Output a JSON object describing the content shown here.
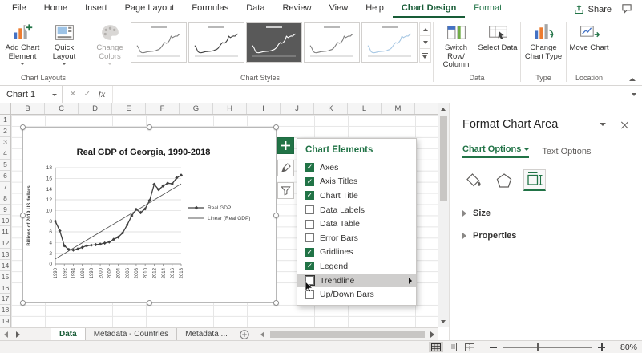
{
  "titlebar": {
    "tabs": [
      {
        "label": "File"
      },
      {
        "label": "Home"
      },
      {
        "label": "Insert"
      },
      {
        "label": "Page Layout"
      },
      {
        "label": "Formulas"
      },
      {
        "label": "Data"
      },
      {
        "label": "Review"
      },
      {
        "label": "View"
      },
      {
        "label": "Help"
      },
      {
        "label": "Chart Design",
        "contextual": true,
        "active": true
      },
      {
        "label": "Format",
        "contextual": true
      }
    ],
    "share_label": "Share"
  },
  "ribbon": {
    "add_chart_element": "Add Chart Element",
    "quick_layout": "Quick Layout",
    "change_colors": "Change Colors",
    "switch_row_column": "Switch Row/ Column",
    "select_data": "Select Data",
    "change_chart_type": "Change Chart Type",
    "move_chart": "Move Chart",
    "groups": {
      "chart_layouts": "Chart Layouts",
      "chart_styles": "Chart Styles",
      "data": "Data",
      "type": "Type",
      "location": "Location"
    },
    "chart_style_count": 5
  },
  "formula_bar": {
    "name_box": "Chart 1",
    "cancel_glyph": "✕",
    "enter_glyph": "✓",
    "fx_glyph": "fx",
    "formula_value": ""
  },
  "sheet": {
    "columns": [
      "B",
      "C",
      "D",
      "E",
      "F",
      "G",
      "H",
      "I",
      "J",
      "K",
      "L",
      "M"
    ],
    "rows": [
      "1",
      "2",
      "3",
      "4",
      "5",
      "6",
      "7",
      "8",
      "9",
      "10",
      "11",
      "12",
      "13",
      "14",
      "15",
      "16",
      "17",
      "18",
      "19"
    ]
  },
  "chart_elements_panel": {
    "title": "Chart Elements",
    "items": [
      {
        "label": "Axes",
        "checked": true
      },
      {
        "label": "Axis Titles",
        "checked": true
      },
      {
        "label": "Chart Title",
        "checked": true
      },
      {
        "label": "Data Labels",
        "checked": false
      },
      {
        "label": "Data Table",
        "checked": false
      },
      {
        "label": "Error Bars",
        "checked": false
      },
      {
        "label": "Gridlines",
        "checked": true
      },
      {
        "label": "Legend",
        "checked": true
      },
      {
        "label": "Trendline",
        "checked": false,
        "highlighted": true,
        "has_arrow": true,
        "cursor": true
      },
      {
        "label": "Up/Down Bars",
        "checked": false
      }
    ]
  },
  "sheet_tabs": {
    "tabs": [
      {
        "label": "Data",
        "active": true
      },
      {
        "label": "Metadata - Countries"
      },
      {
        "label": "Metadata ..."
      }
    ]
  },
  "task_pane": {
    "title": "Format Chart Area",
    "tab_chart_options": "Chart Options",
    "tab_text_options": "Text Options",
    "section_size": "Size",
    "section_properties": "Properties"
  },
  "status_bar": {
    "zoom_label": "80%"
  },
  "chart_data": {
    "type": "line",
    "title": "Real GDP of Georgia, 1990-2018",
    "ylabel": "Billions of 2019 US dollars",
    "x": [
      1990,
      1991,
      1992,
      1993,
      1994,
      1995,
      1996,
      1997,
      1998,
      1999,
      2000,
      2001,
      2002,
      2003,
      2004,
      2005,
      2006,
      2007,
      2008,
      2009,
      2010,
      2011,
      2012,
      2013,
      2014,
      2015,
      2016,
      2017,
      2018
    ],
    "x_tick_step": 2,
    "ylim": [
      0,
      18
    ],
    "y_tick_step": 2,
    "grid": true,
    "legend_position": "right",
    "series": [
      {
        "name": "Real GDP",
        "values": [
          8.0,
          6.2,
          3.4,
          2.7,
          2.6,
          2.8,
          3.1,
          3.4,
          3.5,
          3.6,
          3.7,
          3.9,
          4.1,
          4.6,
          5.0,
          5.8,
          7.3,
          9.0,
          10.2,
          9.6,
          10.3,
          11.9,
          14.9,
          13.9,
          14.6,
          15.1,
          15.0,
          16.1,
          16.6
        ]
      }
    ],
    "trendline": {
      "name": "Linear (Real GDP)",
      "kind": "linear"
    }
  },
  "colors": {
    "excel_green": "#217346",
    "active_tab_green": "#185c37",
    "series_color": "#404040",
    "trendline_color": "#595959"
  }
}
